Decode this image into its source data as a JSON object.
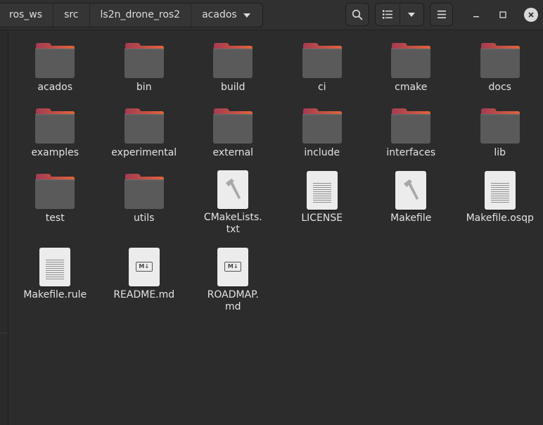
{
  "breadcrumb": [
    "ros_ws",
    "src",
    "ls2n_drone_ros2",
    "acados"
  ],
  "header_buttons": {
    "search": "search-icon",
    "view_list": "list-view-icon",
    "view_options": "chevron-down-icon",
    "menu": "hamburger-menu-icon"
  },
  "window_controls": [
    "minimize-icon",
    "maximize-icon",
    "close-icon"
  ],
  "colors": {
    "background": "#2c2c2c",
    "folder_body": "#5a5a5a",
    "folder_tab_start": "#a33b52",
    "folder_tab_end": "#e2643a"
  },
  "files": [
    {
      "name": "acados",
      "type": "folder"
    },
    {
      "name": "bin",
      "type": "folder"
    },
    {
      "name": "build",
      "type": "folder"
    },
    {
      "name": "ci",
      "type": "folder"
    },
    {
      "name": "cmake",
      "type": "folder"
    },
    {
      "name": "docs",
      "type": "folder"
    },
    {
      "name": "examples",
      "type": "folder"
    },
    {
      "name": "experimental",
      "type": "folder"
    },
    {
      "name": "external",
      "type": "folder"
    },
    {
      "name": "include",
      "type": "folder"
    },
    {
      "name": "interfaces",
      "type": "folder"
    },
    {
      "name": "lib",
      "type": "folder"
    },
    {
      "name": "test",
      "type": "folder"
    },
    {
      "name": "utils",
      "type": "folder"
    },
    {
      "name": "CMakeLists.\ntxt",
      "type": "build"
    },
    {
      "name": "LICENSE",
      "type": "text"
    },
    {
      "name": "Makefile",
      "type": "build"
    },
    {
      "name": "Makefile.osqp",
      "type": "text"
    },
    {
      "name": "Makefile.rule",
      "type": "text"
    },
    {
      "name": "README.md",
      "type": "markdown"
    },
    {
      "name": "ROADMAP.\nmd",
      "type": "markdown"
    }
  ]
}
